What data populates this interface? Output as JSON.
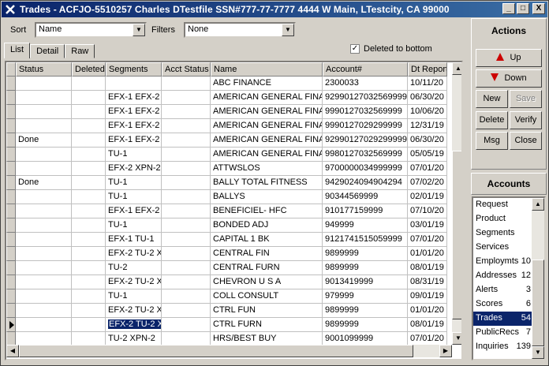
{
  "window": {
    "title": "Trades - ACFJO-5510257  Charles DTestfile  SSN#777-77-7777  4444 W Main, LTestcity, CA 99000",
    "min_glyph": "_",
    "max_glyph": "□",
    "close_glyph": "X"
  },
  "toolbar": {
    "sort_label": "Sort",
    "sort_value": "Name",
    "filters_label": "Filters",
    "filters_value": "None"
  },
  "tabs": [
    {
      "label": "List",
      "active": true
    },
    {
      "label": "Detail",
      "active": false
    },
    {
      "label": "Raw",
      "active": false
    }
  ],
  "deleted_to_bottom": {
    "label": "Deleted to bottom",
    "checked": true
  },
  "grid": {
    "columns": [
      "Status",
      "Deleted",
      "Segments",
      "Acct Status",
      "Name",
      "Account#",
      "Dt Report"
    ],
    "rows": [
      [
        "",
        "",
        "",
        "",
        "ABC FINANCE",
        "2300033",
        "10/11/20"
      ],
      [
        "",
        "",
        "EFX-1 EFX-2 1",
        "",
        "AMERICAN GENERAL FINAN",
        "92990127032569999",
        "06/30/20"
      ],
      [
        "",
        "",
        "EFX-1 EFX-2 1",
        "",
        "AMERICAN GENERAL FINAN",
        "9990127032569999",
        "10/06/20"
      ],
      [
        "",
        "",
        "EFX-1 EFX-2 1",
        "",
        "AMERICAN GENERAL FINAN",
        "9990127029299999",
        "12/31/19"
      ],
      [
        "Done",
        "",
        "EFX-1 EFX-2 1",
        "",
        "AMERICAN GENERAL FINAN",
        "92990127029299999",
        "06/30/20"
      ],
      [
        "",
        "",
        "TU-1",
        "",
        "AMERICAN GENERAL FINAN",
        "9980127032569999",
        "05/05/19"
      ],
      [
        "",
        "",
        "EFX-2 XPN-2",
        "",
        "ATTWSLOS",
        "9700000034999999",
        "07/01/20"
      ],
      [
        "Done",
        "",
        "TU-1",
        "",
        "BALLY TOTAL FITNESS",
        "9429024094904294",
        "07/02/20"
      ],
      [
        "",
        "",
        "TU-1",
        "",
        "BALLYS",
        "90344569999",
        "02/01/19"
      ],
      [
        "",
        "",
        "EFX-1 EFX-2 1",
        "",
        "BENEFICIEL- HFC",
        "910177159999",
        "07/10/20"
      ],
      [
        "",
        "",
        "TU-1",
        "",
        "BONDED ADJ",
        "949999",
        "03/01/19"
      ],
      [
        "",
        "",
        "EFX-1 TU-1",
        "",
        "CAPITAL 1 BK",
        "9121741515059999",
        "07/01/20"
      ],
      [
        "",
        "",
        "EFX-2 TU-2 XI",
        "",
        "CENTRAL FIN",
        "9899999",
        "01/01/20"
      ],
      [
        "",
        "",
        "TU-2",
        "",
        "CENTRAL FURN",
        "9899999",
        "08/01/19"
      ],
      [
        "",
        "",
        "EFX-2 TU-2 XI",
        "",
        "CHEVRON U S A",
        "9013419999",
        "08/31/19"
      ],
      [
        "",
        "",
        "TU-1",
        "",
        "COLL CONSULT",
        "979999",
        "09/01/19"
      ],
      [
        "",
        "",
        "EFX-2 TU-2 XI",
        "",
        "CTRL FUN",
        "9899999",
        "01/01/20"
      ],
      [
        "",
        "",
        "EFX-2 TU-2 X",
        "",
        "CTRL FURN",
        "9899999",
        "08/01/19"
      ],
      [
        "",
        "",
        "TU-2 XPN-2",
        "",
        "HRS/BEST BUY",
        "9001099999",
        "07/01/20"
      ]
    ],
    "current_row": 17
  },
  "actions": {
    "title": "Actions",
    "up": "Up",
    "down": "Down",
    "new": "New",
    "save": "Save",
    "delete": "Delete",
    "verify": "Verify",
    "msg": "Msg",
    "close": "Close"
  },
  "accounts": {
    "title": "Accounts",
    "items": [
      {
        "label": "Request",
        "count": ""
      },
      {
        "label": "Product",
        "count": ""
      },
      {
        "label": "Segments",
        "count": ""
      },
      {
        "label": "Services",
        "count": ""
      },
      {
        "label": "Employmts",
        "count": "10"
      },
      {
        "label": "Addresses",
        "count": "12"
      },
      {
        "label": "Alerts",
        "count": "3"
      },
      {
        "label": "Scores",
        "count": "6"
      },
      {
        "label": "Trades",
        "count": "54"
      },
      {
        "label": "PublicRecs",
        "count": "7"
      },
      {
        "label": "Inquiries",
        "count": "139"
      }
    ],
    "selected": "Trades"
  }
}
